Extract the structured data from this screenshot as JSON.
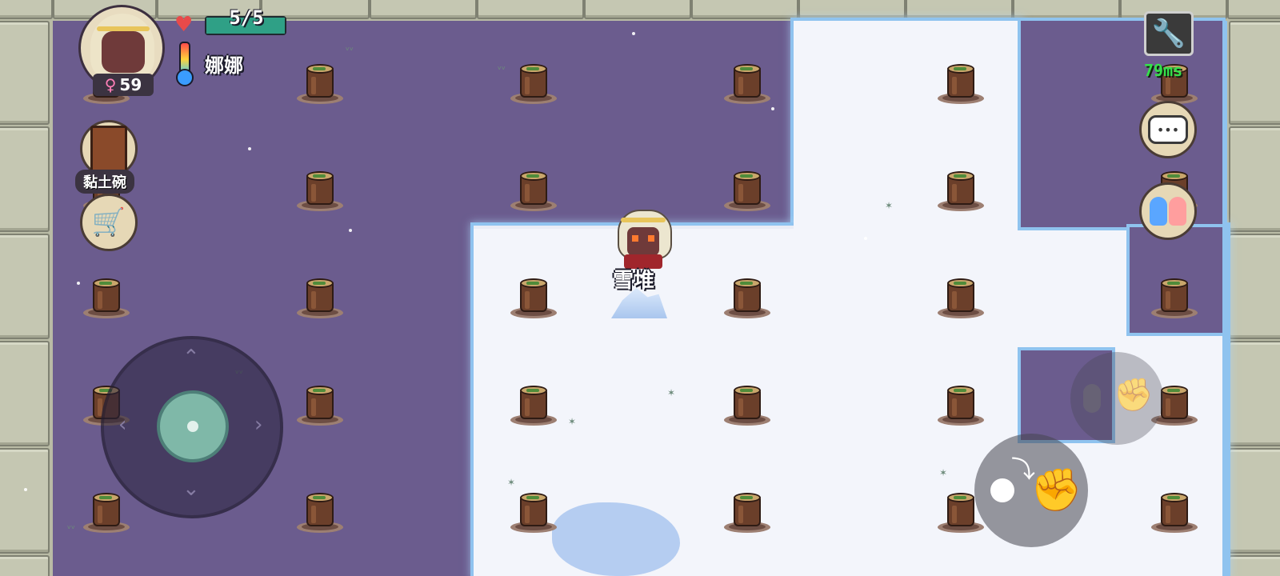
{
  "hud": {
    "hp_text": "5/5",
    "hp_fraction": 1.0,
    "player_name": "娜娜",
    "gender_icon": "female-icon",
    "age": "59",
    "ping": "79ms"
  },
  "left_menu": {
    "recipe_book_label": "黏土碗",
    "shop_icon": "shopping-cart-icon"
  },
  "world": {
    "held_item_label": "雪堆"
  },
  "right_menu": {
    "settings_icon": "wrench-icon",
    "chat_icon": "speech-bubble-icon",
    "social_icon": "two-people-icon"
  },
  "controls": {
    "joystick_icon": "dpad-icon",
    "action_icon": "throw-fist-icon",
    "secondary_action_icon": "grab-fist-icon"
  },
  "colors": {
    "purple_floor": "#6b5c8e",
    "snow": "#eef1f8",
    "snow_edge": "#8fc3ef",
    "hp_green": "#2fa086",
    "ping_green": "#35e04a"
  }
}
